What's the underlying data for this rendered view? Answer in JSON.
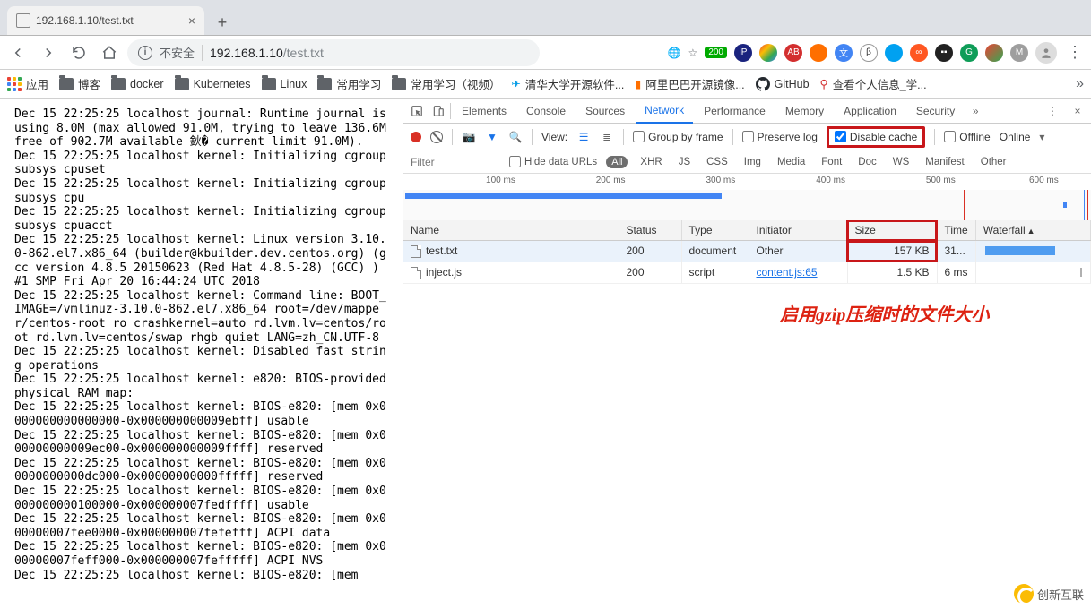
{
  "tab": {
    "title": "192.168.1.10/test.txt"
  },
  "nav": {
    "insecure_label": "不安全",
    "url_host": "192.168.1.10",
    "url_path": "/test.txt",
    "http_badge": "200"
  },
  "bookmarks": {
    "apps": "应用",
    "items": [
      "博客",
      "docker",
      "Kubernetes",
      "Linux",
      "常用学习",
      "常用学习（视频）",
      "清华大学开源软件...",
      "阿里巴巴开源镜像...",
      "GitHub",
      "查看个人信息_学..."
    ]
  },
  "page_body": "Dec 15 22:25:25 localhost journal: Runtime journal is using 8.0M (max allowed 91.0M, trying to leave 136.6M free of 902.7M available 鈥� current limit 91.0M).\nDec 15 22:25:25 localhost kernel: Initializing cgroup subsys cpuset\nDec 15 22:25:25 localhost kernel: Initializing cgroup subsys cpu\nDec 15 22:25:25 localhost kernel: Initializing cgroup subsys cpuacct\nDec 15 22:25:25 localhost kernel: Linux version 3.10.0-862.el7.x86_64 (builder@kbuilder.dev.centos.org) (gcc version 4.8.5 20150623 (Red Hat 4.8.5-28) (GCC) ) #1 SMP Fri Apr 20 16:44:24 UTC 2018\nDec 15 22:25:25 localhost kernel: Command line: BOOT_IMAGE=/vmlinuz-3.10.0-862.el7.x86_64 root=/dev/mapper/centos-root ro crashkernel=auto rd.lvm.lv=centos/root rd.lvm.lv=centos/swap rhgb quiet LANG=zh_CN.UTF-8\nDec 15 22:25:25 localhost kernel: Disabled fast string operations\nDec 15 22:25:25 localhost kernel: e820: BIOS-provided physical RAM map:\nDec 15 22:25:25 localhost kernel: BIOS-e820: [mem 0x0000000000000000-0x000000000009ebff] usable\nDec 15 22:25:25 localhost kernel: BIOS-e820: [mem 0x000000000009ec00-0x000000000009ffff] reserved\nDec 15 22:25:25 localhost kernel: BIOS-e820: [mem 0x00000000000dc000-0x00000000000fffff] reserved\nDec 15 22:25:25 localhost kernel: BIOS-e820: [mem 0x0000000000100000-0x000000007fedffff] usable\nDec 15 22:25:25 localhost kernel: BIOS-e820: [mem 0x000000007fee0000-0x000000007fefefff] ACPI data\nDec 15 22:25:25 localhost kernel: BIOS-e820: [mem 0x000000007feff000-0x000000007fefffff] ACPI NVS\nDec 15 22:25:25 localhost kernel: BIOS-e820: [mem",
  "devtools": {
    "tabs": [
      "Elements",
      "Console",
      "Sources",
      "Network",
      "Performance",
      "Memory",
      "Application",
      "Security"
    ],
    "active_tab": "Network",
    "toolbar": {
      "view_label": "View:",
      "group_by_frame": "Group by frame",
      "preserve_log": "Preserve log",
      "disable_cache": "Disable cache",
      "offline": "Offline",
      "online": "Online"
    },
    "filter": {
      "placeholder": "Filter",
      "hide_data_urls": "Hide data URLs",
      "types": [
        "All",
        "XHR",
        "JS",
        "CSS",
        "Img",
        "Media",
        "Font",
        "Doc",
        "WS",
        "Manifest",
        "Other"
      ]
    },
    "timeline": {
      "ticks": [
        "100 ms",
        "200 ms",
        "300 ms",
        "400 ms",
        "500 ms",
        "600 ms"
      ]
    },
    "columns": [
      "Name",
      "Status",
      "Type",
      "Initiator",
      "Size",
      "Time",
      "Waterfall"
    ],
    "rows": [
      {
        "name": "test.txt",
        "status": "200",
        "type": "document",
        "initiator": "Other",
        "initiator_muted": true,
        "size": "157 KB",
        "time": "31...",
        "selected": true,
        "size_highlight": true
      },
      {
        "name": "inject.js",
        "status": "200",
        "type": "script",
        "initiator": "content.js:65",
        "initiator_link": true,
        "size": "1.5 KB",
        "time": "6 ms"
      }
    ]
  },
  "annotation_text": "启用gzip压缩时的文件大小",
  "watermark_text": "创新互联"
}
